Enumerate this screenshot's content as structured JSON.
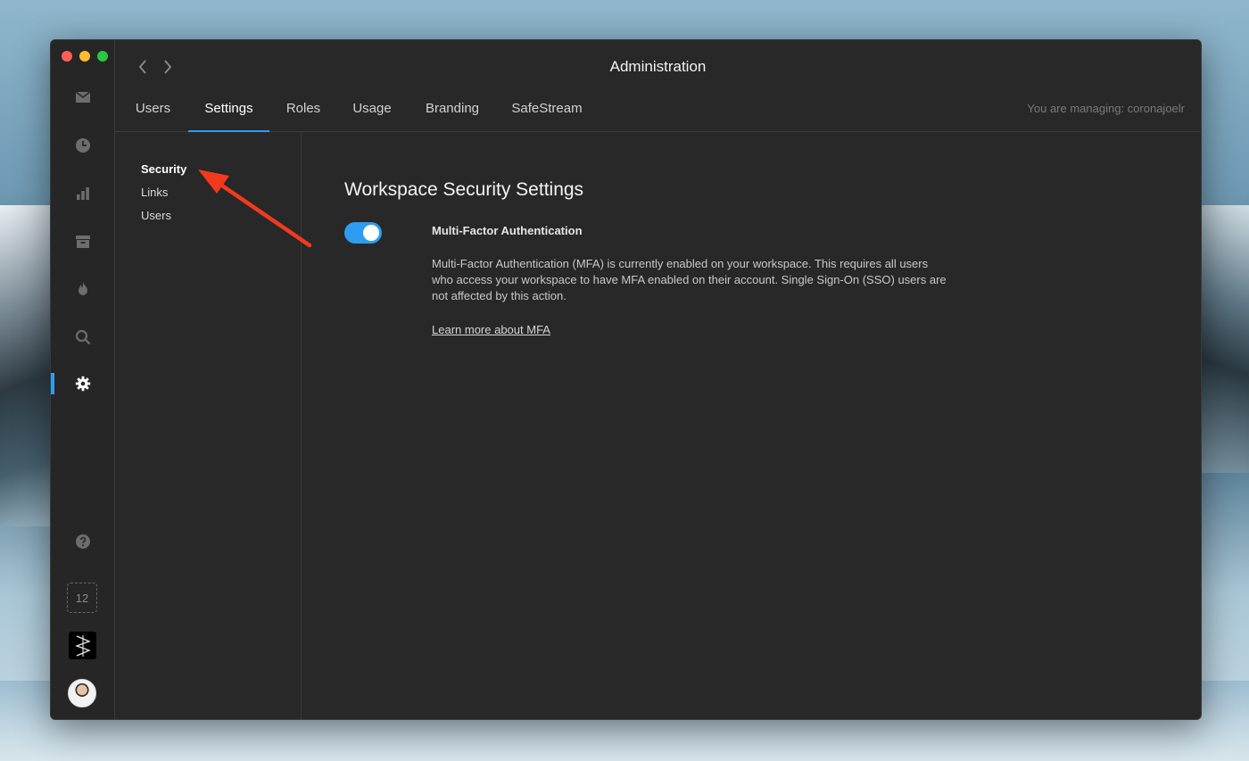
{
  "window": {
    "title": "Administration"
  },
  "header": {
    "managing_text": "You are managing: coronajoelr"
  },
  "tabs": [
    {
      "label": "Users",
      "active": false
    },
    {
      "label": "Settings",
      "active": true
    },
    {
      "label": "Roles",
      "active": false
    },
    {
      "label": "Usage",
      "active": false
    },
    {
      "label": "Branding",
      "active": false
    },
    {
      "label": "SafeStream",
      "active": false
    }
  ],
  "sidebar": {
    "icons": [
      "mail-icon",
      "clock-icon",
      "bar-chart-icon",
      "archive-icon",
      "flame-icon",
      "search-icon",
      "gear-icon",
      "help-icon"
    ],
    "active_icon": "gear-icon",
    "badge_count": "12"
  },
  "subnav": {
    "items": [
      {
        "label": "Security",
        "active": true
      },
      {
        "label": "Links",
        "active": false
      },
      {
        "label": "Users",
        "active": false
      }
    ]
  },
  "security": {
    "heading": "Workspace Security Settings",
    "mfa": {
      "enabled": true,
      "title": "Multi-Factor Authentication",
      "description": "Multi-Factor Authentication (MFA) is currently enabled on your workspace. This requires all users who access your workspace to have MFA enabled on their account. Single Sign-On (SSO) users are not affected by this action.",
      "link_label": "Learn more about MFA"
    }
  },
  "colors": {
    "accent": "#2d9cf1",
    "annotation_arrow": "#f23a1d",
    "window_bg": "#282828"
  }
}
